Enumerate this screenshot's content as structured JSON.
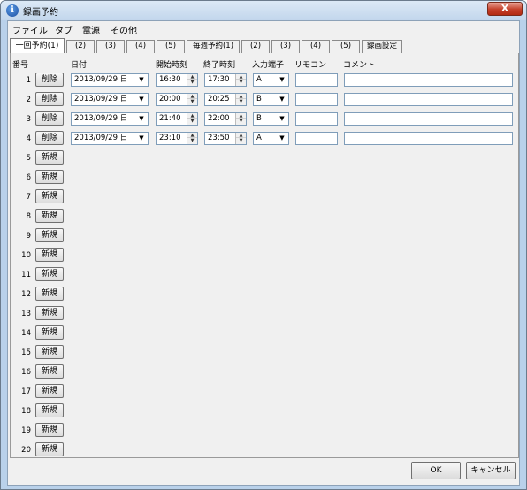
{
  "window": {
    "title": "録画予約",
    "close_label": "X"
  },
  "menu": [
    {
      "label": "ファイル"
    },
    {
      "label": "タブ"
    },
    {
      "label": "電源"
    },
    {
      "label": "その他"
    }
  ],
  "tabs": [
    {
      "label": "一回予約(1)",
      "active": true
    },
    {
      "label": "(2)"
    },
    {
      "label": "(3)"
    },
    {
      "label": "(4)"
    },
    {
      "label": "(5)"
    },
    {
      "label": "毎週予約(1)"
    },
    {
      "label": "(2)"
    },
    {
      "label": "(3)"
    },
    {
      "label": "(4)"
    },
    {
      "label": "(5)"
    },
    {
      "label": "録画設定"
    }
  ],
  "headers": {
    "number": "番号",
    "date": "日付",
    "start_time": "開始時刻",
    "end_time": "終了時刻",
    "input": "入力端子",
    "remote": "リモコン",
    "comment": "コメント"
  },
  "reservations": [
    {
      "num": "1",
      "button": "削除",
      "date": "2013/09/29 日",
      "start": "16:30",
      "end": "17:30",
      "input": "A",
      "remote": "",
      "comment": ""
    },
    {
      "num": "2",
      "button": "削除",
      "date": "2013/09/29 日",
      "start": "20:00",
      "end": "20:25",
      "input": "B",
      "remote": "",
      "comment": ""
    },
    {
      "num": "3",
      "button": "削除",
      "date": "2013/09/29 日",
      "start": "21:40",
      "end": "22:00",
      "input": "B",
      "remote": "",
      "comment": ""
    },
    {
      "num": "4",
      "button": "削除",
      "date": "2013/09/29 日",
      "start": "23:10",
      "end": "23:50",
      "input": "A",
      "remote": "",
      "comment": ""
    }
  ],
  "empty_rows": [
    {
      "num": "5",
      "button": "新規"
    },
    {
      "num": "6",
      "button": "新規"
    },
    {
      "num": "7",
      "button": "新規"
    },
    {
      "num": "8",
      "button": "新規"
    },
    {
      "num": "9",
      "button": "新規"
    },
    {
      "num": "10",
      "button": "新規"
    },
    {
      "num": "11",
      "button": "新規"
    },
    {
      "num": "12",
      "button": "新規"
    },
    {
      "num": "13",
      "button": "新規"
    },
    {
      "num": "14",
      "button": "新規"
    },
    {
      "num": "15",
      "button": "新規"
    },
    {
      "num": "16",
      "button": "新規"
    },
    {
      "num": "17",
      "button": "新規"
    },
    {
      "num": "18",
      "button": "新規"
    },
    {
      "num": "19",
      "button": "新規"
    },
    {
      "num": "20",
      "button": "新規"
    }
  ],
  "glyphs": {
    "dropdown": "▼",
    "spin_up": "▲",
    "spin_down": "▼"
  },
  "footer": {
    "ok_label": "OK",
    "cancel_label": "キャンセル"
  }
}
